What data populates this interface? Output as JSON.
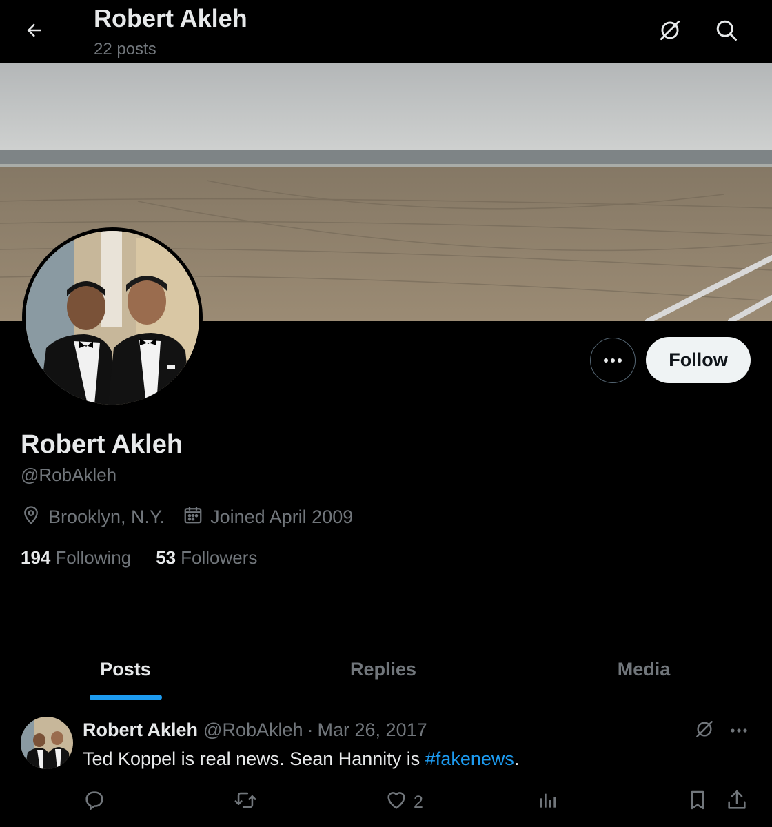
{
  "header": {
    "name": "Robert Akleh",
    "posts_count": "22 posts"
  },
  "profile": {
    "name": "Robert Akleh",
    "handle": "@RobAkleh",
    "location": "Brooklyn, N.Y.",
    "joined": "Joined April 2009",
    "following_count": "194",
    "following_label": "Following",
    "followers_count": "53",
    "followers_label": "Followers",
    "follow_label": "Follow"
  },
  "tabs": [
    {
      "label": "Posts",
      "active": true
    },
    {
      "label": "Replies",
      "active": false
    },
    {
      "label": "Media",
      "active": false
    }
  ],
  "tweet": {
    "name": "Robert Akleh",
    "handle": "@RobAkleh",
    "separator": "·",
    "date": "Mar 26, 2017",
    "text_before": "Ted Koppel is real news. Sean Hannity is ",
    "hashtag": "#fakenews",
    "text_after": ".",
    "like_count": "2"
  },
  "icons": {
    "back": "arrow-left-icon",
    "grok": "grok-icon",
    "search": "search-icon",
    "location": "location-pin-icon",
    "calendar": "calendar-icon",
    "more": "more-dots-icon",
    "reply": "reply-icon",
    "retweet": "retweet-icon",
    "like": "heart-icon",
    "views": "views-icon",
    "bookmark": "bookmark-icon",
    "share": "share-icon"
  },
  "colors": {
    "background": "#000000",
    "text_primary": "#e7e9ea",
    "text_secondary": "#71767b",
    "accent": "#1d9bf0",
    "follow_button_bg": "#eff3f4",
    "divider": "#2f3336"
  }
}
